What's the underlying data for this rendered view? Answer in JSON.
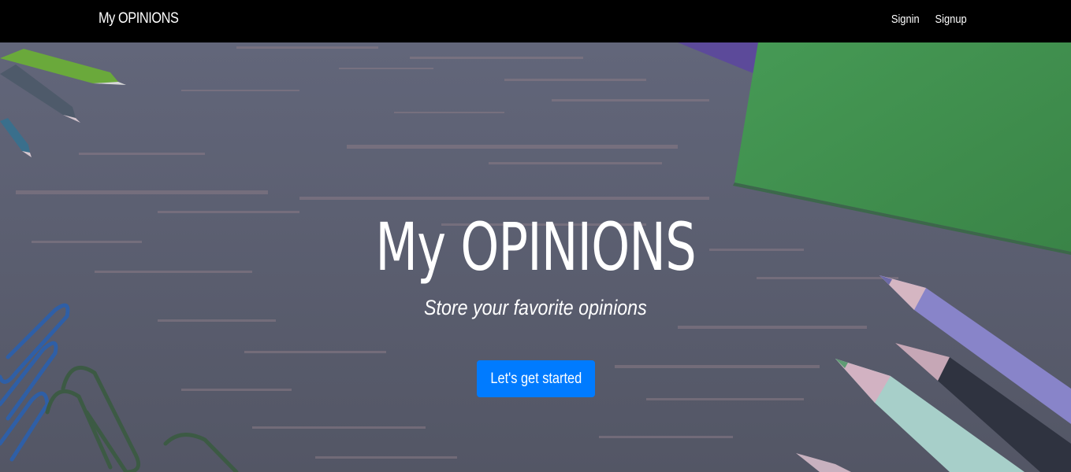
{
  "navbar": {
    "brand": "My OPINIONS",
    "links": [
      {
        "label": "Signin"
      },
      {
        "label": "Signup"
      }
    ]
  },
  "hero": {
    "title": "My OPINIONS",
    "subtitle": "Store your favorite opinions",
    "cta_label": "Let's get started"
  },
  "colors": {
    "navbar_bg": "#000000",
    "hero_bg": "#5d6170",
    "cta_bg": "#007bff",
    "notebook_green": "#3f8e4d",
    "text": "#ffffff"
  }
}
